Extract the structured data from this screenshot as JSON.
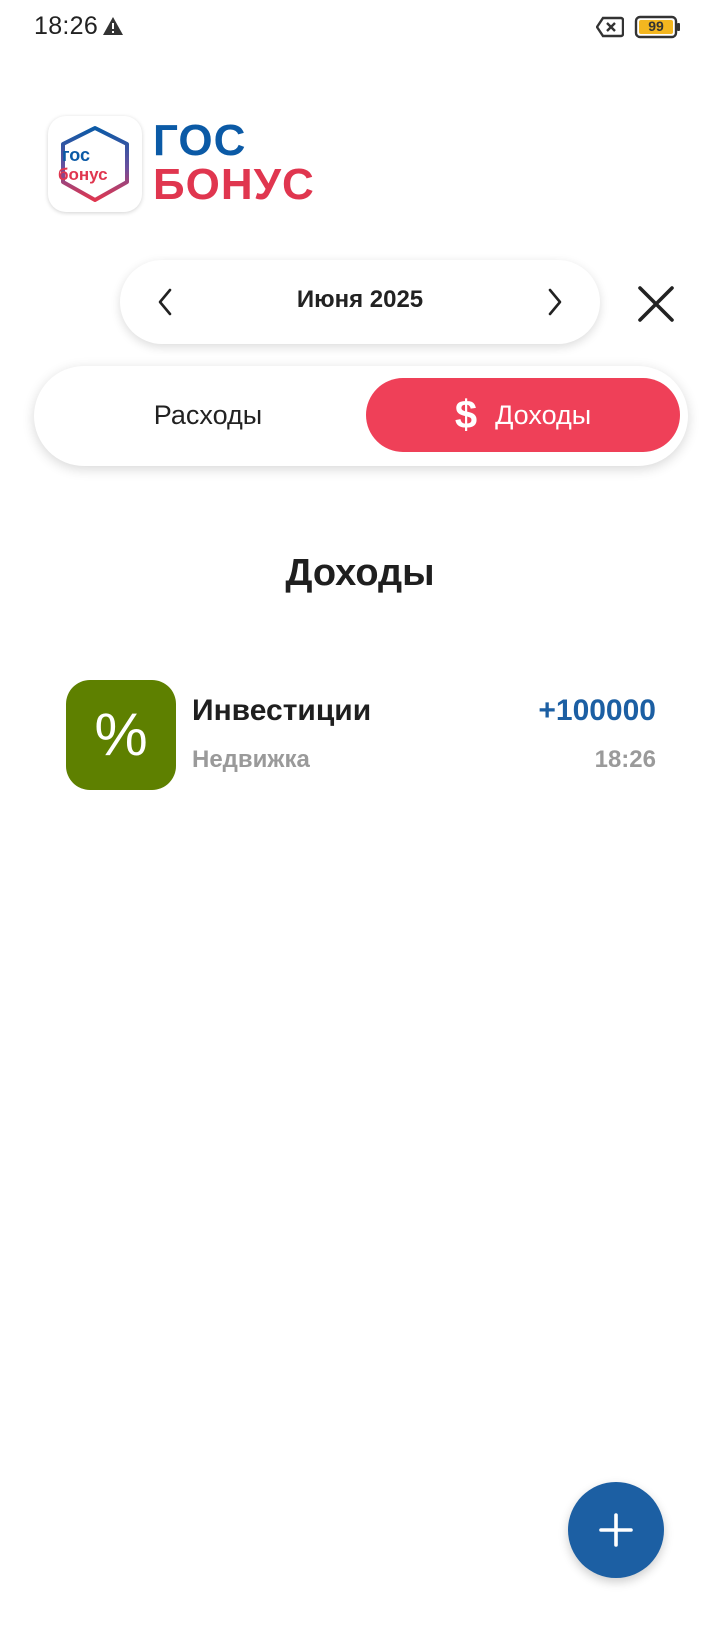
{
  "status_bar": {
    "time": "18:26",
    "battery_level": "99",
    "icons": [
      "warning-icon",
      "sim-off-icon",
      "battery-icon"
    ]
  },
  "logo": {
    "inner_top": "гос",
    "inner_bottom": "бонус",
    "word_top": "ГОС",
    "word_bottom": "БОНУС",
    "colors": {
      "blue": "#0b5aa6",
      "red": "#e0364f"
    }
  },
  "month_selector": {
    "label": "Июня 2025",
    "prev_icon": "chevron-left-icon",
    "next_icon": "chevron-right-icon"
  },
  "close_icon": "close-icon",
  "toggle": {
    "expenses_label": "Расходы",
    "income_label": "Доходы",
    "income_icon": "$",
    "selected": "income",
    "accent": "#ef4058"
  },
  "section_title": "Доходы",
  "transactions": [
    {
      "icon": "%",
      "icon_color": "#5e8000",
      "title": "Инвестиции",
      "subtitle": "Недвижка",
      "amount": "+100000",
      "time": "18:26"
    }
  ],
  "fab": {
    "icon": "plus-icon",
    "color": "#1c5fa3"
  }
}
